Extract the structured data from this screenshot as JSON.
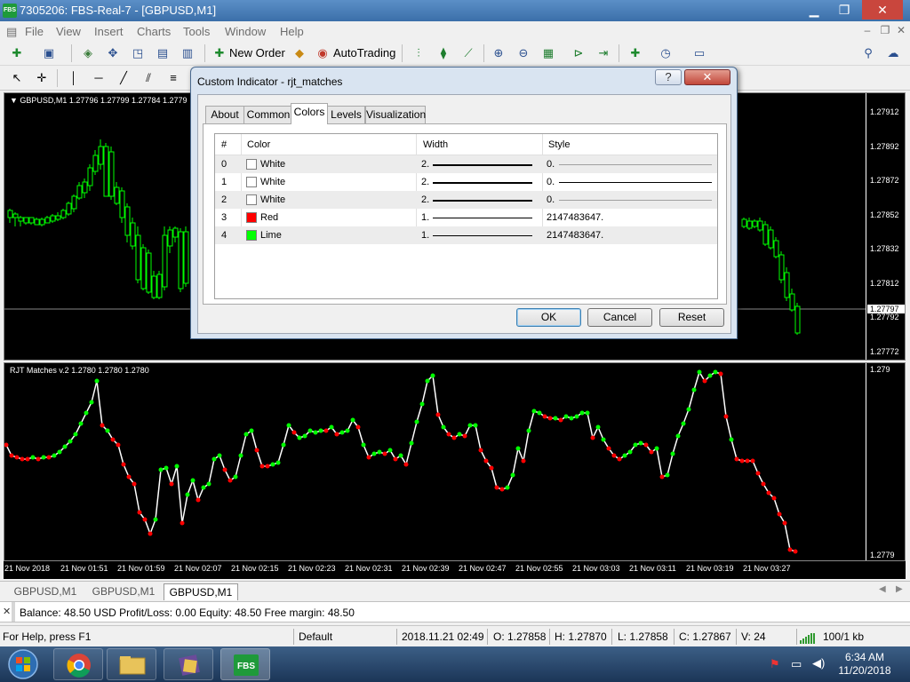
{
  "window": {
    "title": "7305206: FBS-Real-7 - [GBPUSD,M1]",
    "app_badge": "FBS",
    "min": "▁",
    "max": "❐",
    "close": "✕"
  },
  "menu": {
    "items": [
      "File",
      "View",
      "Insert",
      "Charts",
      "Tools",
      "Window",
      "Help"
    ],
    "mdi_min": "‒",
    "mdi_restore": "❐",
    "mdi_close": "✕"
  },
  "toolbar": {
    "new_order": "New Order",
    "autotrading": "AutoTrading"
  },
  "main_chart": {
    "label": "▼ GBPUSD,M1  1.27796 1.27799 1.27784 1.2779",
    "price_labels": [
      "1.27912",
      "1.27892",
      "1.27872",
      "1.27852",
      "1.27832",
      "1.27812",
      "1.27792",
      "1.27772"
    ],
    "current_price": "1.27797"
  },
  "indicator_chart": {
    "label": "RJT Matches v.2 1.2780 1.2780 1.2780",
    "price_labels": [
      "1.279",
      "1.2779"
    ]
  },
  "time_labels": [
    "21 Nov 2018",
    "21 Nov 01:51",
    "21 Nov 01:59",
    "21 Nov 02:07",
    "21 Nov 02:15",
    "21 Nov 02:23",
    "21 Nov 02:31",
    "21 Nov 02:39",
    "21 Nov 02:47",
    "21 Nov 02:55",
    "21 Nov 03:03",
    "21 Nov 03:11",
    "21 Nov 03:19",
    "21 Nov 03:27"
  ],
  "chart_tabs": [
    "GBPUSD,M1",
    "GBPUSD,M1",
    "GBPUSD,M1"
  ],
  "terminal": {
    "text": "Balance: 48.50 USD  Profit/Loss: 0.00  Equity: 48.50  Free margin: 48.50"
  },
  "status": {
    "help": "For Help, press F1",
    "profile": "Default",
    "datetime": "2018.11.21 02:49",
    "open": "O: 1.27858",
    "high": "H: 1.27870",
    "low": "L: 1.27858",
    "close": "C: 1.27867",
    "volume": "V: 24",
    "traffic": "100/1 kb"
  },
  "taskbar": {
    "time": "6:34 AM",
    "date": "11/20/2018",
    "fbs_label": "FBS"
  },
  "dialog": {
    "title": "Custom Indicator - rjt_matches",
    "help": "?",
    "close": "✕",
    "tabs": [
      "About",
      "Common",
      "Colors",
      "Levels",
      "Visualization"
    ],
    "active_tab": "Colors",
    "columns": [
      "#",
      "Color",
      "Width",
      "Style"
    ],
    "rows": [
      {
        "index": "0",
        "color_name": "White",
        "color": "#ffffff",
        "width": "2.",
        "style": "0."
      },
      {
        "index": "1",
        "color_name": "White",
        "color": "#ffffff",
        "width": "2.",
        "style": "0."
      },
      {
        "index": "2",
        "color_name": "White",
        "color": "#ffffff",
        "width": "2.",
        "style": "0."
      },
      {
        "index": "3",
        "color_name": "Red",
        "color": "#ff0000",
        "width": "1.",
        "style": "2147483647."
      },
      {
        "index": "4",
        "color_name": "Lime",
        "color": "#00ff00",
        "width": "1.",
        "style": "2147483647."
      }
    ],
    "ok": "OK",
    "cancel": "Cancel",
    "reset": "Reset"
  }
}
